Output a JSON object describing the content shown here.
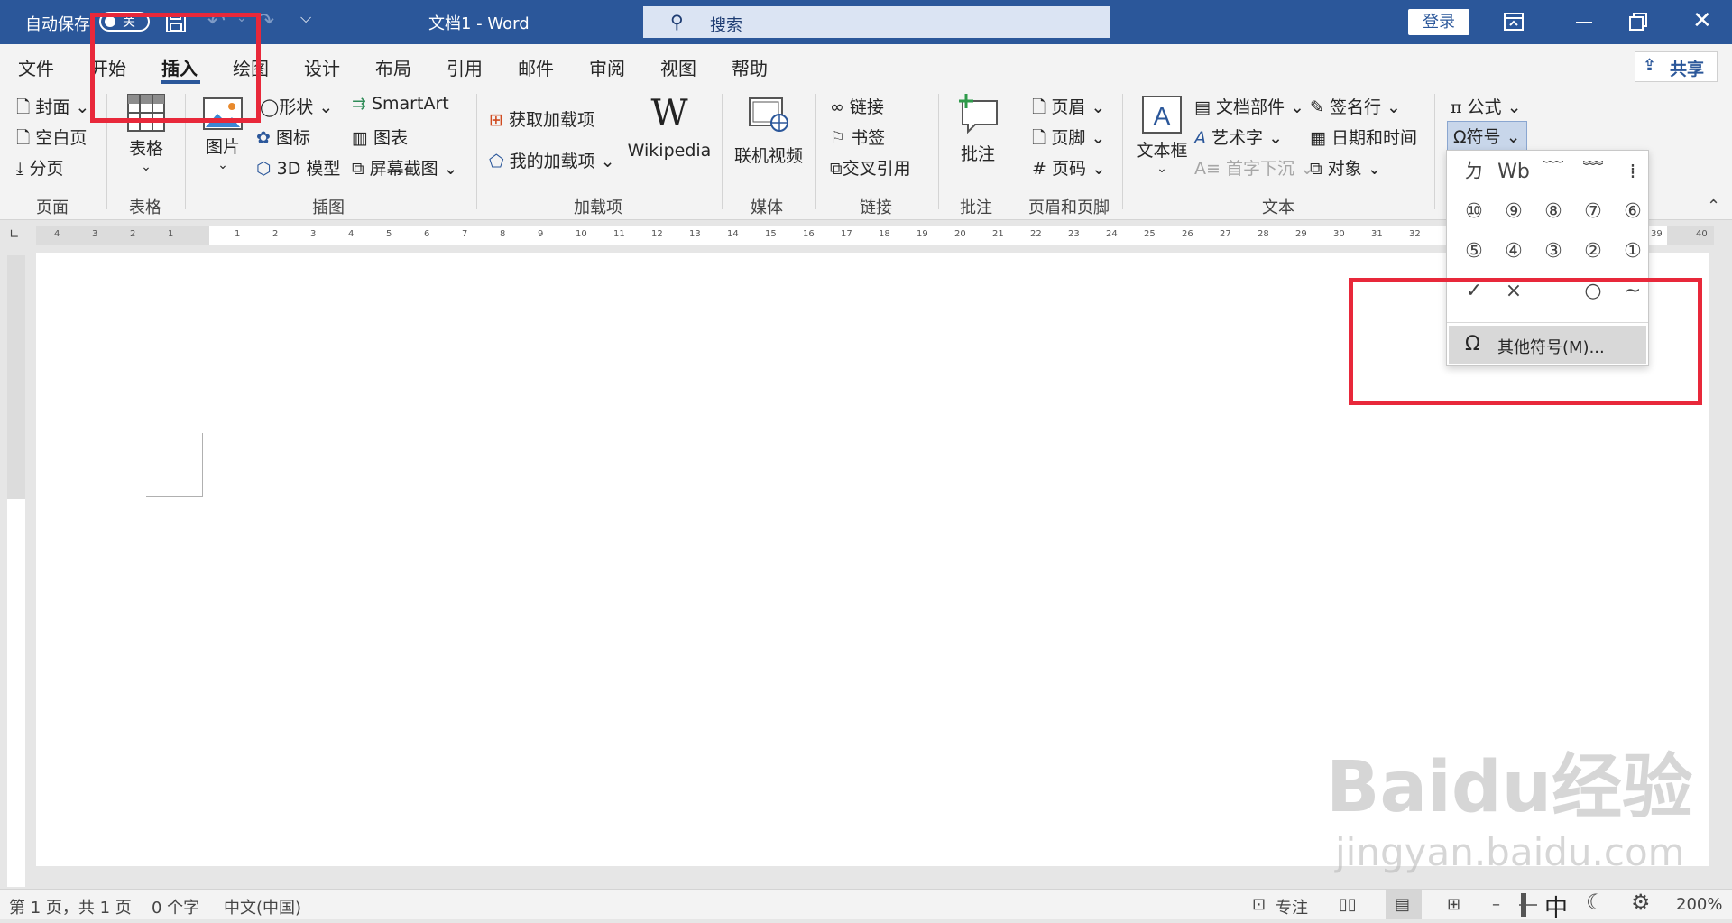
{
  "titlebar": {
    "autosave_label": "自动保存",
    "autosave_state": "关",
    "doc_title": "文档1  -  Word",
    "search_placeholder": "搜索",
    "login": "登录"
  },
  "tabs": [
    "文件",
    "开始",
    "插入",
    "绘图",
    "设计",
    "布局",
    "引用",
    "邮件",
    "审阅",
    "视图",
    "帮助"
  ],
  "active_tab": "插入",
  "share": "共享",
  "ribbon": {
    "pages": {
      "cover": "封面",
      "blank": "空白页",
      "break": "分页",
      "group": "页面"
    },
    "table": {
      "label": "表格",
      "group": "表格"
    },
    "illustrations": {
      "picture": "图片",
      "shapes": "形状",
      "icons": "图标",
      "model3d": "3D 模型",
      "smartart": "SmartArt",
      "chart": "图表",
      "screenshot": "屏幕截图",
      "group": "插图"
    },
    "addins": {
      "get": "获取加载项",
      "mine": "我的加载项",
      "wikipedia": "Wikipedia",
      "group": "加载项"
    },
    "media": {
      "video": "联机视频",
      "group": "媒体"
    },
    "links": {
      "link": "链接",
      "bookmark": "书签",
      "crossref": "交叉引用",
      "group": "链接"
    },
    "comments": {
      "comment": "批注",
      "group": "批注"
    },
    "header_footer": {
      "header": "页眉",
      "footer": "页脚",
      "page_number": "页码",
      "group": "页眉和页脚"
    },
    "text": {
      "textbox": "文本框",
      "quickparts": "文档部件",
      "wordart": "艺术字",
      "dropcap": "首字下沉",
      "signature": "签名行",
      "datetime": "日期和时间",
      "object": "对象",
      "group": "文本"
    },
    "symbols": {
      "equation": "公式",
      "symbol": "符号"
    }
  },
  "symbol_dropdown": {
    "rows": [
      [
        "ㄉ",
        "Wb",
        "﹋",
        "﹌",
        "⁞"
      ],
      [
        "⑩",
        "⑨",
        "⑧",
        "⑦",
        "⑥"
      ],
      [
        "⑤",
        "④",
        "③",
        "②",
        "①"
      ],
      [
        "✓",
        "×",
        "",
        "○",
        "~"
      ]
    ],
    "more": "其他符号(M)..."
  },
  "ruler_numbers_left": [
    "4",
    "3",
    "2",
    "1"
  ],
  "ruler_numbers_right": [
    "1",
    "2",
    "3",
    "4",
    "5",
    "6",
    "7",
    "8",
    "9",
    "10",
    "11",
    "12",
    "13",
    "14",
    "15",
    "16",
    "17",
    "18",
    "19",
    "20",
    "21",
    "22",
    "23",
    "24",
    "25",
    "26",
    "27",
    "28",
    "29",
    "30",
    "31",
    "32",
    "39",
    "40"
  ],
  "statusbar": {
    "page": "第 1 页，共 1 页",
    "words": "0 个字",
    "lang": "中文(中国)",
    "focus": "专注",
    "ime": "中",
    "zoom": "200%"
  },
  "watermark": {
    "line1": "Baidu经验",
    "line2": "jingyan.baidu.com"
  },
  "colors": {
    "titlebar": "#2b579a",
    "accent": "#2b579a",
    "highlight_box": "#e8283a"
  }
}
